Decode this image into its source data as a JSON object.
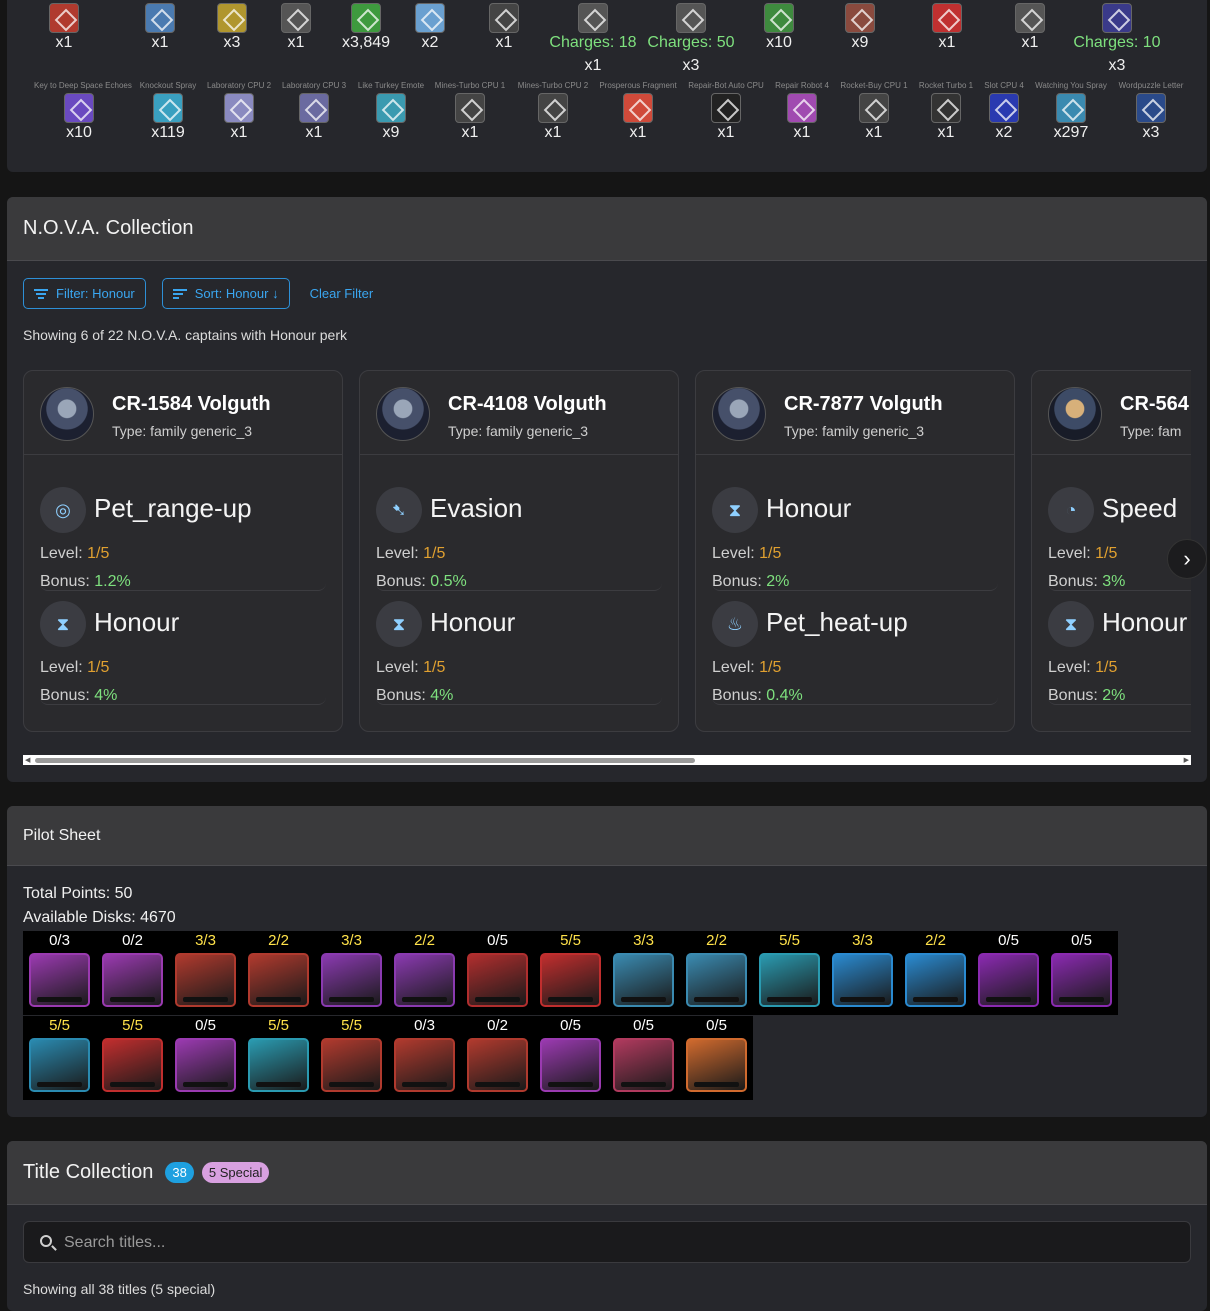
{
  "inventory": {
    "row1": [
      {
        "count": "x1",
        "color": "#b03a2e"
      },
      {
        "count": "x1",
        "color": "#4a7ab0"
      },
      {
        "count": "x3",
        "color": "#b0962e"
      },
      {
        "count": "x1",
        "color": "#555555"
      },
      {
        "count": "x3,849",
        "color": "#3e9a3e"
      },
      {
        "count": "x2",
        "color": "#6aa0d0"
      },
      {
        "count": "x1",
        "color": "#444444"
      },
      {
        "count": "x1",
        "charge": "Charges: 18",
        "color": "#555555"
      },
      {
        "count": "x3",
        "charge": "Charges: 50",
        "color": "#555555"
      },
      {
        "count": "x10",
        "color": "#3e8a3e"
      },
      {
        "count": "x9",
        "color": "#8a4a3e"
      },
      {
        "count": "x1",
        "color": "#c03030"
      },
      {
        "count": "x1",
        "color": "#555555"
      },
      {
        "count": "x3",
        "charge": "Charges: 10",
        "color": "#3a3a8a"
      }
    ],
    "row2": [
      {
        "name": "Key to Deep Space Echoes",
        "count": "x10",
        "color": "#6a4ac0"
      },
      {
        "name": "Knockout Spray",
        "count": "x119",
        "color": "#3aa0c0"
      },
      {
        "name": "Laboratory CPU 2",
        "count": "x1",
        "color": "#8a8ac0"
      },
      {
        "name": "Laboratory CPU 3",
        "count": "x1",
        "color": "#6a6aa0"
      },
      {
        "name": "Like Turkey Emote",
        "count": "x9",
        "color": "#3a9ab0"
      },
      {
        "name": "Mines-Turbo CPU 1",
        "count": "x1",
        "color": "#444444"
      },
      {
        "name": "Mines-Turbo CPU 2",
        "count": "x1",
        "color": "#444444"
      },
      {
        "name": "Prosperous Fragment",
        "count": "x1",
        "color": "#d04a3a"
      },
      {
        "name": "Repair-Bot Auto CPU",
        "count": "x1",
        "color": "#222222"
      },
      {
        "name": "Repair Robot 4",
        "count": "x1",
        "color": "#a04ab0"
      },
      {
        "name": "Rocket-Buy CPU 1",
        "count": "x1",
        "color": "#444444"
      },
      {
        "name": "Rocket Turbo 1",
        "count": "x1",
        "color": "#333333"
      },
      {
        "name": "Slot CPU 4",
        "count": "x2",
        "color": "#2a3ab0"
      },
      {
        "name": "Watching You Spray",
        "count": "x297",
        "color": "#3a8ab0"
      },
      {
        "name": "Wordpuzzle Letter",
        "count": "x3",
        "color": "#2a4a8a"
      }
    ]
  },
  "nova": {
    "title": "N.O.V.A. Collection",
    "filter_label": "Filter: Honour",
    "sort_label": "Sort: Honour ↓",
    "clear_label": "Clear Filter",
    "summary": "Showing 6 of 22 N.O.V.A. captains with Honour perk",
    "captains": [
      {
        "name": "CR-1584 Volguth",
        "type": "Type: family generic_3",
        "perks": [
          {
            "icon": "crosshair-icon",
            "name": "Pet_range-up",
            "level": "1/5",
            "bonus": "1.2%"
          },
          {
            "icon": "hourglass-icon",
            "name": "Honour",
            "level": "1/5",
            "bonus": "4%"
          }
        ]
      },
      {
        "name": "CR-4108 Volguth",
        "type": "Type: family generic_3",
        "perks": [
          {
            "icon": "evasion-icon",
            "name": "Evasion",
            "level": "1/5",
            "bonus": "0.5%"
          },
          {
            "icon": "hourglass-icon",
            "name": "Honour",
            "level": "1/5",
            "bonus": "4%"
          }
        ]
      },
      {
        "name": "CR-7877 Volguth",
        "type": "Type: family generic_3",
        "perks": [
          {
            "icon": "hourglass-icon",
            "name": "Honour",
            "level": "1/5",
            "bonus": "2%"
          },
          {
            "icon": "flame-icon",
            "name": "Pet_heat-up",
            "level": "1/5",
            "bonus": "0.4%"
          }
        ]
      },
      {
        "name": "CR-564",
        "type": "Type: fam",
        "perks": [
          {
            "icon": "speedometer-icon",
            "name": "Speed",
            "level": "1/5",
            "bonus": "3%"
          },
          {
            "icon": "hourglass-icon",
            "name": "Honour",
            "level": "1/5",
            "bonus": "2%"
          }
        ]
      }
    ],
    "level_prefix": "Level: ",
    "bonus_prefix": "Bonus: "
  },
  "pilot": {
    "title": "Pilot Sheet",
    "total_points": "Total Points: 50",
    "available_disks": "Available Disks: 4670",
    "row1": [
      {
        "level": "0/3",
        "color": "#9a3ab0"
      },
      {
        "level": "0/2",
        "color": "#9a3ab0"
      },
      {
        "level": "3/3",
        "color": "#b03a2e"
      },
      {
        "level": "2/2",
        "color": "#b03a2e"
      },
      {
        "level": "3/3",
        "color": "#8a3ab0"
      },
      {
        "level": "2/2",
        "color": "#8a3ab0"
      },
      {
        "level": "0/5",
        "color": "#b02e2e"
      },
      {
        "level": "5/5",
        "color": "#c02e2e"
      },
      {
        "level": "3/3",
        "color": "#3a8ab0"
      },
      {
        "level": "2/2",
        "color": "#3a8ab0"
      },
      {
        "level": "5/5",
        "color": "#2a9ab0"
      },
      {
        "level": "3/3",
        "color": "#2a8ad0"
      },
      {
        "level": "2/2",
        "color": "#2a8ad0"
      },
      {
        "level": "0/5",
        "color": "#8a2ab0"
      },
      {
        "level": "0/5",
        "color": "#8a2ab0"
      }
    ],
    "row2": [
      {
        "level": "5/5",
        "color": "#2a8ab0"
      },
      {
        "level": "5/5",
        "color": "#c02e2e"
      },
      {
        "level": "0/5",
        "color": "#9a3ab0"
      },
      {
        "level": "5/5",
        "color": "#2a9ab0"
      },
      {
        "level": "5/5",
        "color": "#b03a2e"
      },
      {
        "level": "0/3",
        "color": "#b03a2e"
      },
      {
        "level": "0/2",
        "color": "#b03a2e"
      },
      {
        "level": "0/5",
        "color": "#9a3ab0"
      },
      {
        "level": "0/5",
        "color": "#b03a5e"
      },
      {
        "level": "0/5",
        "color": "#d06a2e"
      }
    ]
  },
  "titles": {
    "title": "Title Collection",
    "count_badge": "38",
    "special_badge": "5 Special",
    "badge_colors": {
      "count": "#1ea0e0",
      "special": "#d8a0e0"
    },
    "search_placeholder": "Search titles...",
    "summary": "Showing all 38 titles (5 special)"
  },
  "colors": {
    "accent": "#3aa6f0",
    "level": "#e0a030",
    "bonus": "#7ee07e",
    "charge": "#7ee07e",
    "full_level": "#ffe24a"
  }
}
